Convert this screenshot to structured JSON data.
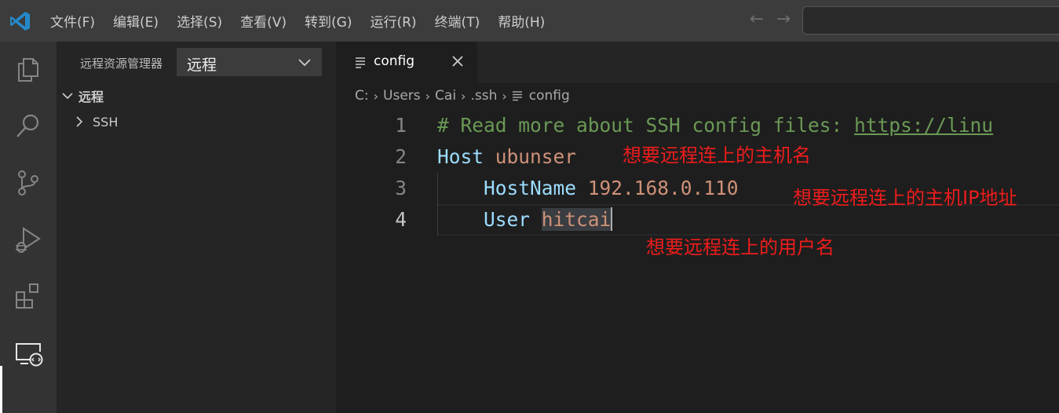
{
  "menu": [
    "文件(F)",
    "编辑(E)",
    "选择(S)",
    "查看(V)",
    "转到(G)",
    "运行(R)",
    "终端(T)",
    "帮助(H)"
  ],
  "nav": {
    "back_icon": "arrow-left-icon",
    "forward_icon": "arrow-right-icon"
  },
  "activity_bar": {
    "items": [
      "files-icon",
      "search-icon",
      "source-control-icon",
      "run-debug-icon",
      "extensions-icon",
      "remote-explorer-icon"
    ],
    "active": "remote-explorer-icon"
  },
  "sidebar": {
    "title": "远程资源管理器",
    "remote_select": {
      "value": "远程"
    },
    "section": "远程",
    "items": [
      {
        "label": "SSH"
      }
    ]
  },
  "tab": {
    "label": "config"
  },
  "breadcrumb": [
    "C:",
    "Users",
    "Cai",
    ".ssh",
    "config"
  ],
  "editor": {
    "lines": [
      {
        "num": "1",
        "comment": "# Read more about SSH config files: ",
        "link": "https://linu"
      },
      {
        "num": "2",
        "key": "Host",
        "value": "ubunser"
      },
      {
        "num": "3",
        "key": "HostName",
        "value": "192.168.0.110"
      },
      {
        "num": "4",
        "key": "User",
        "value": "hitcai"
      }
    ],
    "active_line": "4"
  },
  "annotations": {
    "host": "想要远程连上的主机名",
    "hostname": "想要远程连上的主机IP地址",
    "user": "想要远程连上的用户名"
  },
  "colors": {
    "accent": "#007acc",
    "annotation": "#ee1c1c",
    "comment": "#6a9955",
    "keyword": "#9cdcfe",
    "string": "#ce9178"
  }
}
